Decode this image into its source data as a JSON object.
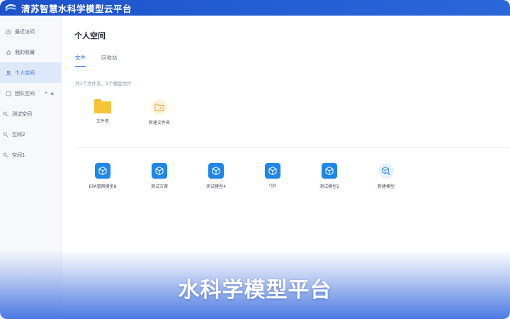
{
  "header": {
    "app_title": "清苏智慧水科学模型云平台",
    "logo": "wave-logo-icon"
  },
  "sidebar": {
    "items": [
      {
        "label": "最近访问",
        "icon": "clock-icon"
      },
      {
        "label": "我的收藏",
        "icon": "star-icon"
      },
      {
        "label": "个人空间",
        "icon": "person-icon",
        "active": true
      },
      {
        "label": "团队空间",
        "icon": "team-icon",
        "expanded": true
      },
      {
        "label": "测试空间",
        "icon": "team-small-icon"
      },
      {
        "label": "空间2",
        "icon": "team-small-icon"
      },
      {
        "label": "空间1",
        "icon": "team-small-icon"
      }
    ],
    "add_symbol": "+",
    "caret_symbol": "▲"
  },
  "main": {
    "page_title": "个人空间",
    "tabs": [
      {
        "label": "文件",
        "active": true
      },
      {
        "label": "回收站",
        "active": false
      }
    ],
    "hint": "共1个文件夹、5个模型文件",
    "folders": [
      {
        "label": "文件夹",
        "icon": "folder-icon"
      },
      {
        "label": "新建文件夹",
        "icon": "new-folder-icon"
      }
    ],
    "models": [
      {
        "label": "EPA管网模型8",
        "icon": "cube-icon"
      },
      {
        "label": "测试方案",
        "icon": "cube-icon"
      },
      {
        "label": "测试模型4",
        "icon": "cube-icon"
      },
      {
        "label": "rgq",
        "icon": "cube-icon"
      },
      {
        "label": "测试模型2",
        "icon": "cube-icon"
      },
      {
        "label": "新建模型",
        "icon": "new-cube-icon"
      }
    ]
  },
  "caption": "水科学模型平台",
  "colors": {
    "header": "#2460d6",
    "accent": "#2d6ae0",
    "model_icon": "#1f86ea",
    "folder": "#f7c437"
  }
}
